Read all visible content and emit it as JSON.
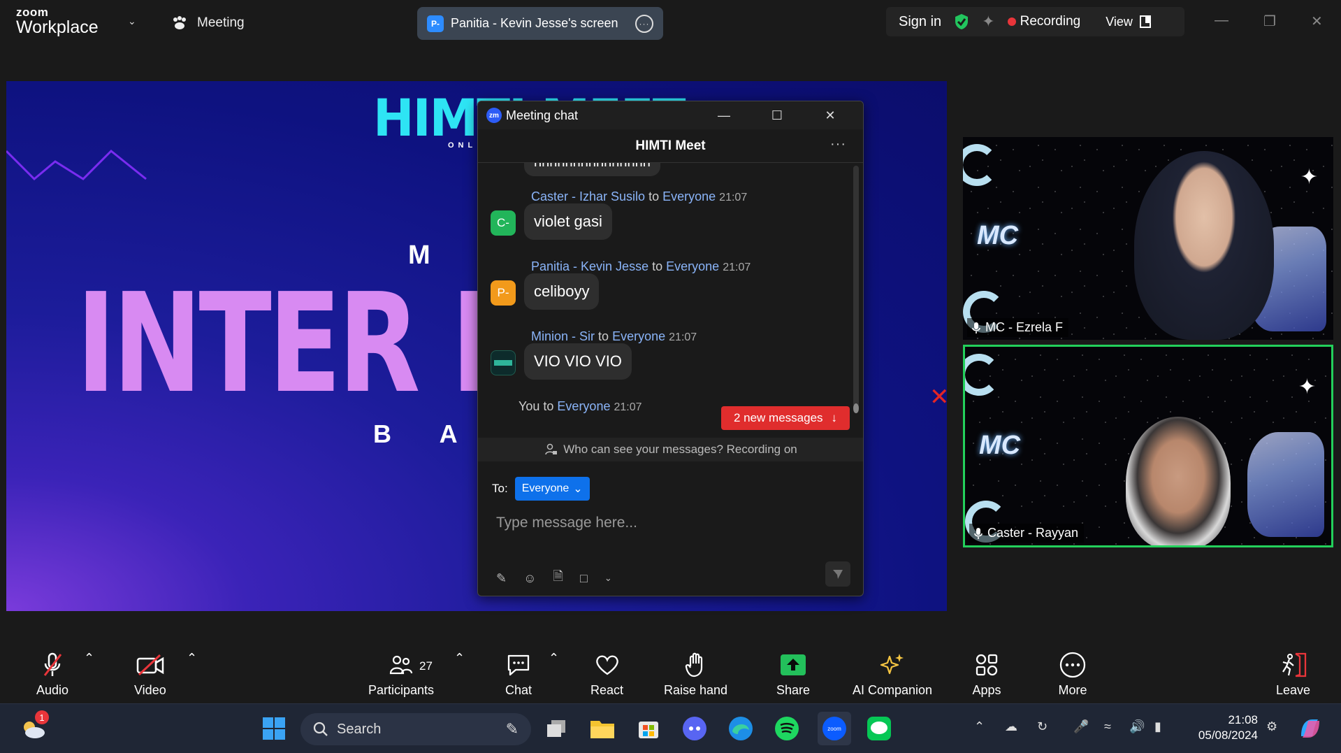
{
  "topbar": {
    "brand_small": "zoom",
    "brand_large": "Workplace",
    "meeting_label": "Meeting",
    "screen_badge": "P-",
    "screen_title": "Panitia - Kevin Jesse's screen",
    "sign_in": "Sign in",
    "recording": "Recording",
    "view": "View"
  },
  "share": {
    "himti": "HIMTI MEET",
    "online": "ONL",
    "ml": "M L",
    "inter": "INTER D",
    "bat": "B A T"
  },
  "tiles": [
    {
      "name": "MC - Ezrela F",
      "logo": "MC"
    },
    {
      "name": "Caster - Rayyan",
      "logo": "MC"
    }
  ],
  "chat": {
    "window_title": "Meeting chat",
    "header": "HIMTI Meet",
    "partial_bubble": "hhhhhhhhhhhhhhh",
    "messages": [
      {
        "sender": "Caster - Izhar Susilo",
        "to": "to",
        "recipient": "Everyone",
        "time": "21:07",
        "avatar": "C-",
        "avatar_color": "#22b55a",
        "text": "violet gasi"
      },
      {
        "sender": "Panitia - Kevin Jesse",
        "to": "to",
        "recipient": "Everyone",
        "time": "21:07",
        "avatar": "P-",
        "avatar_color": "#f29a1b",
        "text": "celiboyy"
      },
      {
        "sender": "Minion - Sir",
        "to": "to",
        "recipient": "Everyone",
        "time": "21:07",
        "avatar": "",
        "avatar_color": "#0d2b2b",
        "text": "VIO VIO VIO"
      },
      {
        "sender": "You",
        "to": "to",
        "recipient": "Everyone",
        "time": "21:07",
        "avatar": "",
        "avatar_color": "",
        "text": ""
      }
    ],
    "new_messages": "2 new messages",
    "privacy": "Who can see your messages? Recording on",
    "to_label": "To:",
    "to_value": "Everyone",
    "placeholder": "Type message here..."
  },
  "toolbar": {
    "audio": "Audio",
    "video": "Video",
    "participants": "Participants",
    "participants_count": "27",
    "chat": "Chat",
    "react": "React",
    "raise_hand": "Raise hand",
    "share": "Share",
    "ai_companion": "AI Companion",
    "apps": "Apps",
    "more": "More",
    "leave": "Leave"
  },
  "taskbar": {
    "search": "Search",
    "weather_badge": "1",
    "time": "21:08",
    "date": "05/08/2024"
  },
  "colors": {
    "accent": "#0e71eb",
    "recording": "#e8353a",
    "active_speaker": "#23d05b",
    "share_icon": "#23c05b",
    "new_messages": "#e02d2d"
  }
}
